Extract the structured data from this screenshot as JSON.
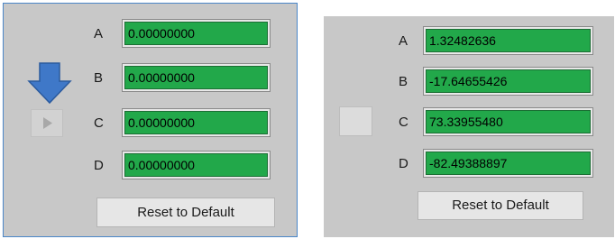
{
  "left_panel": {
    "rows": [
      {
        "label": "A",
        "value": "0.00000000"
      },
      {
        "label": "B",
        "value": "0.00000000"
      },
      {
        "label": "C",
        "value": "0.00000000"
      },
      {
        "label": "D",
        "value": "0.00000000"
      }
    ],
    "reset_label": "Reset to Default",
    "arrow_icon": "arrow-down-icon",
    "play_icon": "play-icon"
  },
  "right_panel": {
    "rows": [
      {
        "label": "A",
        "value": "1.32482636"
      },
      {
        "label": "B",
        "value": "-17.64655426"
      },
      {
        "label": "C",
        "value": "73.33955480"
      },
      {
        "label": "D",
        "value": "-82.49388897"
      }
    ],
    "reset_label": "Reset to Default"
  },
  "colors": {
    "panel_bg": "#c8c8c8",
    "value_green": "#22a84a",
    "arrow_blue": "#3f78c8",
    "left_border": "#4a86c8"
  }
}
